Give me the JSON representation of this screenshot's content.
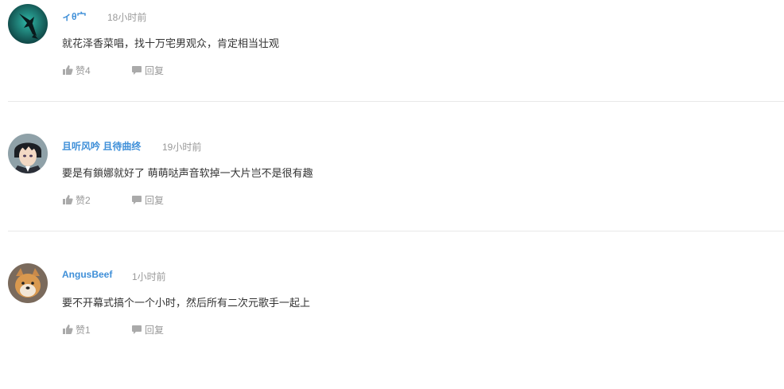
{
  "comments": [
    {
      "username": "ィθ宀",
      "time": "18小时前",
      "content": "就花泽香菜唱，找十万宅男观众，肯定相当壮观",
      "like_label": "赞4",
      "reply_label": "回复",
      "avatar": "shark-avatar"
    },
    {
      "username": "且听风吟 且待曲终",
      "time": "19小时前",
      "content": "要是有鎖娜就好了 萌萌哒声音软掉一大片岂不是很有趣",
      "like_label": "赞2",
      "reply_label": "回复",
      "avatar": "anime-boy-avatar"
    },
    {
      "username": "AngusBeef",
      "time": "1小时前",
      "content": "要不开幕式搞个一个小时，然后所有二次元歌手一起上",
      "like_label": "赞1",
      "reply_label": "回复",
      "avatar": "shiba-dog-avatar"
    }
  ],
  "icons": {
    "like": "thumbs-up-icon",
    "reply": "speech-bubble-icon"
  },
  "colors": {
    "username": "#3f8fd8",
    "meta": "#999999",
    "text": "#333333",
    "divider": "#e8e8e8"
  }
}
